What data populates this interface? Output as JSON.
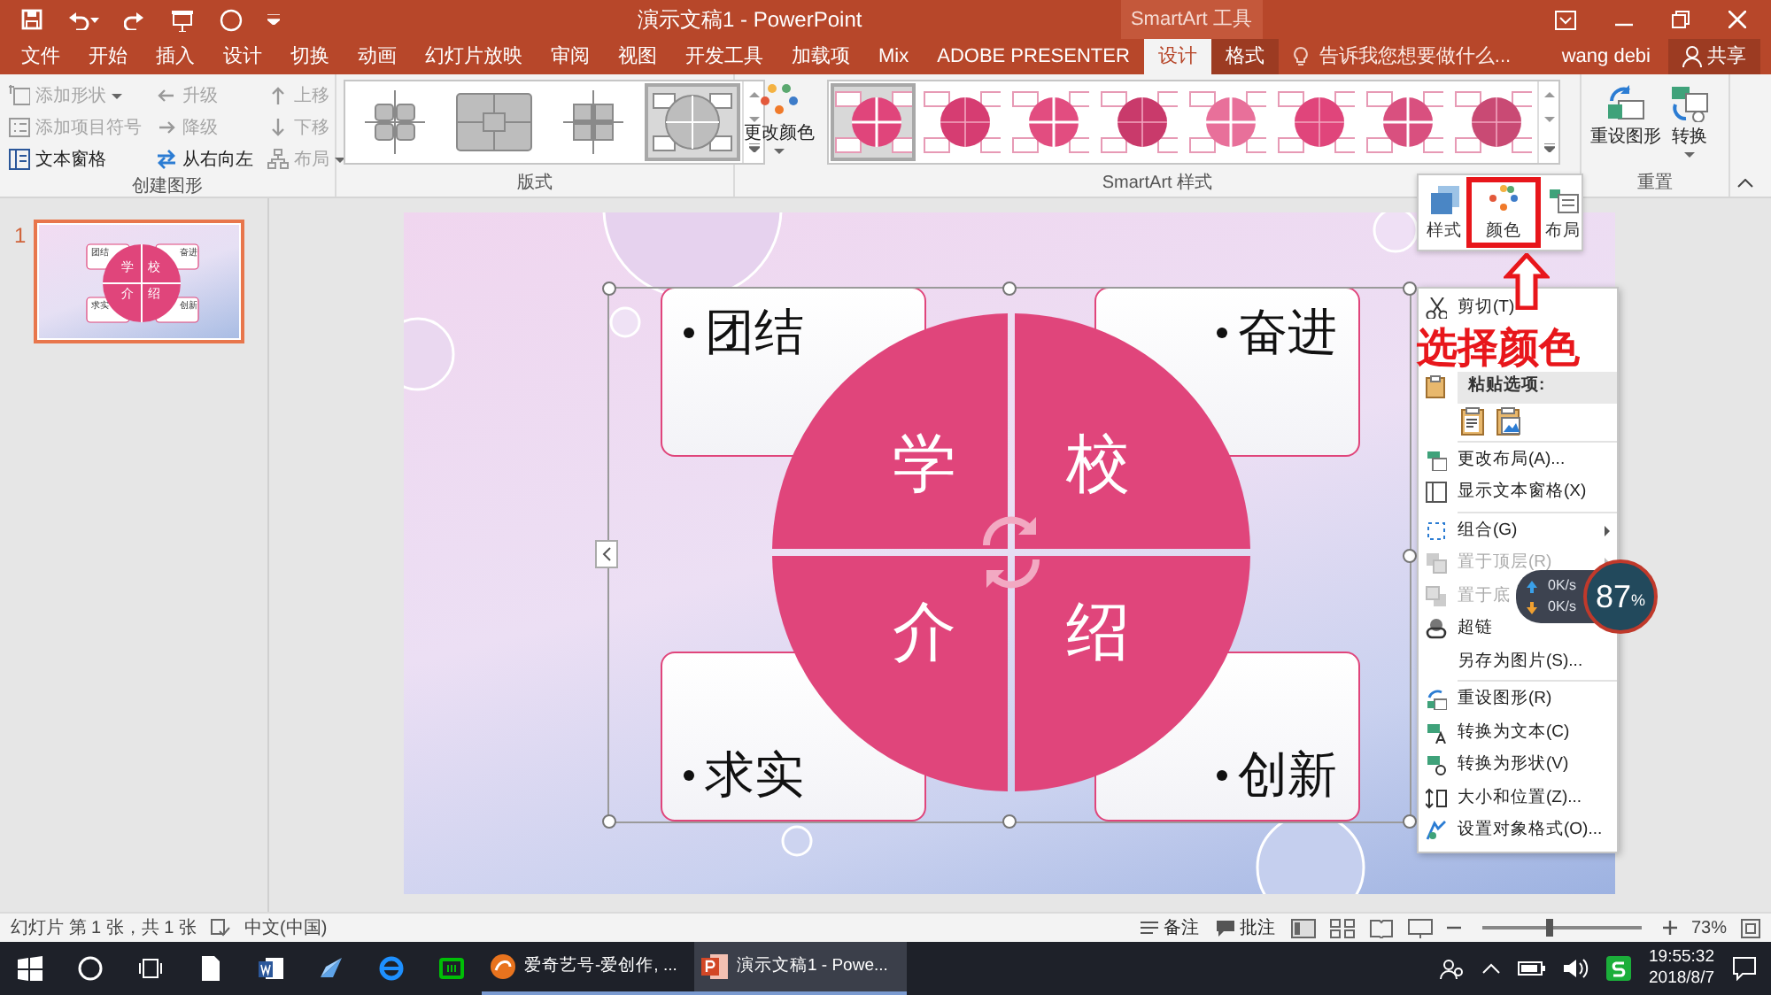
{
  "window": {
    "title": "演示文稿1 - PowerPoint",
    "tool_group": "SmartArt 工具"
  },
  "tabs": [
    {
      "label": "文件",
      "selected": false,
      "kind": "main"
    },
    {
      "label": "开始",
      "selected": false,
      "kind": "main"
    },
    {
      "label": "插入",
      "selected": false,
      "kind": "main"
    },
    {
      "label": "设计",
      "selected": false,
      "kind": "main"
    },
    {
      "label": "切换",
      "selected": false,
      "kind": "main"
    },
    {
      "label": "动画",
      "selected": false,
      "kind": "main"
    },
    {
      "label": "幻灯片放映",
      "selected": false,
      "kind": "main"
    },
    {
      "label": "审阅",
      "selected": false,
      "kind": "main"
    },
    {
      "label": "视图",
      "selected": false,
      "kind": "main"
    },
    {
      "label": "开发工具",
      "selected": false,
      "kind": "main"
    },
    {
      "label": "加载项",
      "selected": false,
      "kind": "main"
    },
    {
      "label": "Mix",
      "selected": false,
      "kind": "main"
    },
    {
      "label": "ADOBE PRESENTER",
      "selected": false,
      "kind": "main"
    },
    {
      "label": "设计",
      "selected": true,
      "kind": "context"
    },
    {
      "label": "格式",
      "selected": false,
      "kind": "context"
    }
  ],
  "tell_me": {
    "placeholder": "告诉我您想要做什么..."
  },
  "account": {
    "user": "wang debi",
    "share": "共享"
  },
  "ribbon": {
    "create_graphic": {
      "title": "创建图形",
      "columns": [
        {
          "commands": [
            {
              "label": "添加形状",
              "disabled": true,
              "dropdown": true
            },
            {
              "label": "添加项目符号",
              "disabled": true,
              "dropdown": false
            },
            {
              "label": "文本窗格",
              "disabled": false,
              "dropdown": false
            }
          ]
        },
        {
          "commands": [
            {
              "label": "升级",
              "disabled": true,
              "dropdown": false
            },
            {
              "label": "降级",
              "disabled": true,
              "dropdown": false
            },
            {
              "label": "从右向左",
              "disabled": false,
              "dropdown": false
            }
          ]
        },
        {
          "commands": [
            {
              "label": "上移",
              "disabled": true,
              "dropdown": false
            },
            {
              "label": "下移",
              "disabled": true,
              "dropdown": false
            },
            {
              "label": "布局",
              "disabled": true,
              "dropdown": true
            }
          ]
        }
      ]
    },
    "layouts": {
      "title": "版式",
      "items": [
        {
          "selected": false
        },
        {
          "selected": false
        },
        {
          "selected": false
        },
        {
          "selected": true
        }
      ]
    },
    "styles": {
      "title": "SmartArt 样式",
      "change_colors": "更改颜色",
      "items": [
        {
          "selected": true
        },
        {
          "selected": false
        },
        {
          "selected": false
        },
        {
          "selected": false
        },
        {
          "selected": false
        },
        {
          "selected": false
        },
        {
          "selected": false
        },
        {
          "selected": false
        }
      ]
    },
    "reset": {
      "title": "重置",
      "buttons": [
        {
          "label": "重设图形",
          "dropdown": false
        },
        {
          "label": "转换",
          "dropdown": true
        }
      ]
    }
  },
  "thumbnails": [
    {
      "number": "1",
      "selected": true,
      "nodes": [
        "团结",
        "奋进",
        "求实",
        "创新"
      ],
      "circle_labels": [
        "学",
        "校",
        "介",
        "绍"
      ]
    }
  ],
  "slide": {
    "nodes": [
      "团结",
      "奋进",
      "求实",
      "创新"
    ],
    "circle_labels": [
      "学",
      "校",
      "介",
      "绍"
    ]
  },
  "mini_toolbar": {
    "buttons": [
      {
        "label": "样式",
        "highlighted": false
      },
      {
        "label": "颜色",
        "highlighted": true
      },
      {
        "label": "布局",
        "highlighted": false
      }
    ]
  },
  "annotation": {
    "text": "选择颜色"
  },
  "context_menu": {
    "items": [
      {
        "kind": "item",
        "label": "剪切(T)",
        "disabled": false,
        "submenu": false
      },
      {
        "kind": "header",
        "label": "粘贴选项:"
      },
      {
        "kind": "paste"
      },
      {
        "kind": "separator"
      },
      {
        "kind": "item",
        "label": "更改布局(A)...",
        "disabled": false,
        "submenu": false
      },
      {
        "kind": "item",
        "label": "显示文本窗格(X)",
        "disabled": false,
        "submenu": false
      },
      {
        "kind": "separator"
      },
      {
        "kind": "item",
        "label": "组合(G)",
        "disabled": false,
        "submenu": true
      },
      {
        "kind": "item",
        "label": "置于顶层(R)",
        "disabled": true,
        "submenu": true
      },
      {
        "kind": "item",
        "label": "置于底",
        "disabled": true,
        "submenu": false
      },
      {
        "kind": "item",
        "label": "超链",
        "disabled": false,
        "submenu": false
      },
      {
        "kind": "item",
        "label": "另存为图片(S)...",
        "disabled": false,
        "submenu": false
      },
      {
        "kind": "separator"
      },
      {
        "kind": "item",
        "label": "重设图形(R)",
        "disabled": false,
        "submenu": false
      },
      {
        "kind": "item",
        "label": "转换为文本(C)",
        "disabled": false,
        "submenu": false
      },
      {
        "kind": "item",
        "label": "转换为形状(V)",
        "disabled": false,
        "submenu": false
      },
      {
        "kind": "item",
        "label": "大小和位置(Z)...",
        "disabled": false,
        "submenu": false
      },
      {
        "kind": "item",
        "label": "设置对象格式(O)...",
        "disabled": false,
        "submenu": false
      }
    ]
  },
  "speed_widget": {
    "upload": "0K/s",
    "download": "0K/s",
    "value": "87",
    "unit": "%"
  },
  "status_bar": {
    "slide_info": "幻灯片 第 1 张，共 1 张",
    "language": "中文(中国)",
    "notes": "备注",
    "comments": "批注",
    "zoom": {
      "level": 0.42
    },
    "zoom_text": "73%"
  },
  "taskbar": {
    "apps": [
      {
        "label": "爱奇艺号-爱创作, ...",
        "active": false
      },
      {
        "label": "演示文稿1 - Powe...",
        "active": true
      }
    ],
    "time": "19:55:32",
    "date": "2018/8/7"
  }
}
